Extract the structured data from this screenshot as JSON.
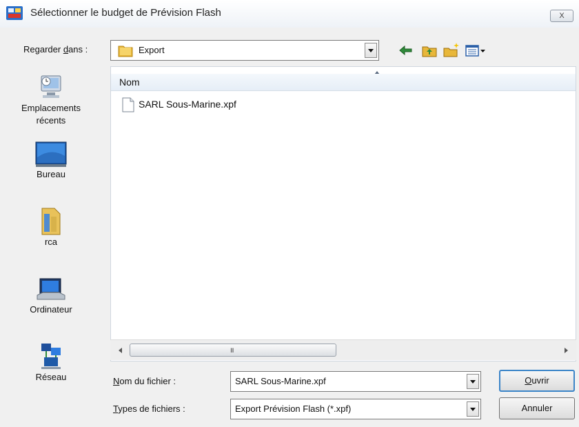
{
  "window": {
    "title": "Sélectionner le budget de Prévision Flash",
    "close_label": "X"
  },
  "look_in": {
    "label_before": "Regarder ",
    "label_accel": "d",
    "label_after": "ans :",
    "value": "Export"
  },
  "toolbar": {
    "icons": [
      "back-arrow-icon",
      "up-one-level-icon",
      "new-folder-icon",
      "view-menu-icon"
    ]
  },
  "places": [
    {
      "label": "Emplacements récents",
      "icon": "recent-places-icon"
    },
    {
      "label": "Bureau",
      "icon": "desktop-icon"
    },
    {
      "label": "rca",
      "icon": "user-folder-icon"
    },
    {
      "label": "Ordinateur",
      "icon": "computer-icon"
    },
    {
      "label": "Réseau",
      "icon": "network-icon"
    }
  ],
  "file_list": {
    "column_header": "Nom",
    "files": [
      {
        "name": "SARL Sous-Marine.xpf",
        "icon": "document-icon"
      }
    ]
  },
  "scrollbar": {
    "grip": "III"
  },
  "file_name": {
    "label_accel": "N",
    "label_rest": "om du fichier :",
    "value": "SARL Sous-Marine.xpf"
  },
  "file_type": {
    "label_accel": "T",
    "label_rest": "ypes de fichiers :",
    "value": "Export Prévision Flash (*.xpf)"
  },
  "buttons": {
    "open_accel": "O",
    "open_rest": "uvrir",
    "cancel": "Annuler"
  },
  "colors": {
    "header_bg": "#e6eef7",
    "default_button_border": "#3a84c8"
  }
}
